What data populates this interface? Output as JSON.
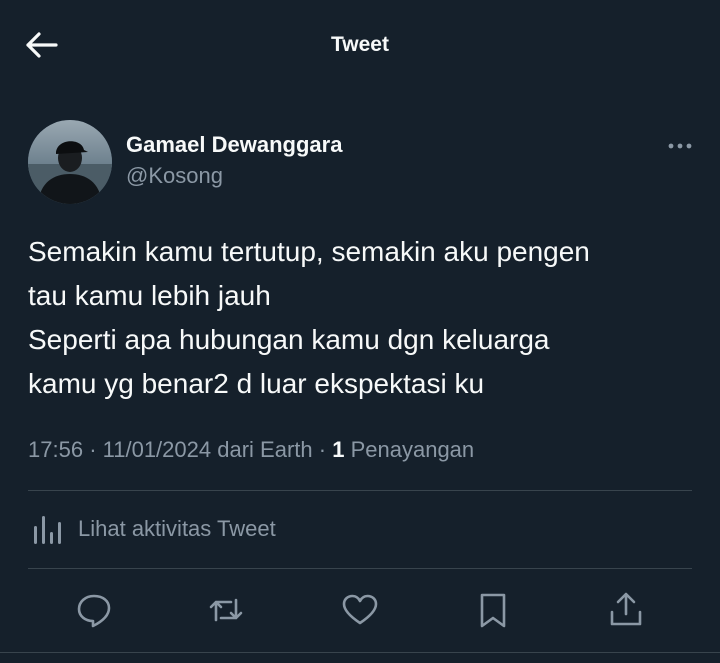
{
  "header": {
    "title": "Tweet"
  },
  "author": {
    "name": "Gamael Dewanggara",
    "handle": "@Kosong"
  },
  "tweet": {
    "lines": [
      "Semakin kamu tertutup, semakin aku pengen",
      "tau kamu lebih jauh",
      "Seperti apa hubungan kamu dgn keluarga",
      "kamu yg benar2 d luar ekspektasi ku"
    ],
    "time": "17:56",
    "date": "11/01/2024",
    "source": "dari Earth",
    "separator": "·",
    "views_count": "1",
    "views_label": "Penayangan"
  },
  "activity": {
    "label": "Lihat aktivitas Tweet"
  },
  "actions": [
    "reply-icon",
    "retweet-icon",
    "like-icon",
    "bookmark-icon",
    "share-icon"
  ],
  "colors": {
    "background": "#15202b",
    "text": "#f7f9f9",
    "secondary": "#8b98a5",
    "divider": "#38444d"
  }
}
